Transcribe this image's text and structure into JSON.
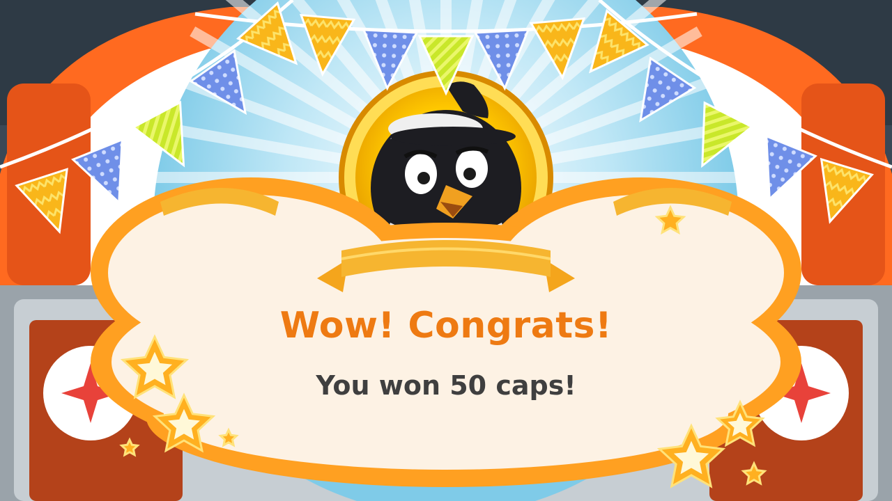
{
  "reward_popup": {
    "title": "Wow! Congrats!",
    "message": "You won 50 caps!",
    "character_icon": "black-penguin-bird-icon",
    "decoration_icon": "star-icon"
  },
  "colors": {
    "title": "#ee7a12",
    "message": "#3f3f3f",
    "frame_orange": "#ff6a20",
    "ribbon": "#f4a51c",
    "cloud_fill": "#fdf2e4",
    "medal_gold": "#f7b800"
  },
  "bunting": {
    "flag_colors": [
      "#f9b61a",
      "#8fc9ff",
      "#c9e72a",
      "#6f8fe8",
      "#e8423a"
    ]
  }
}
